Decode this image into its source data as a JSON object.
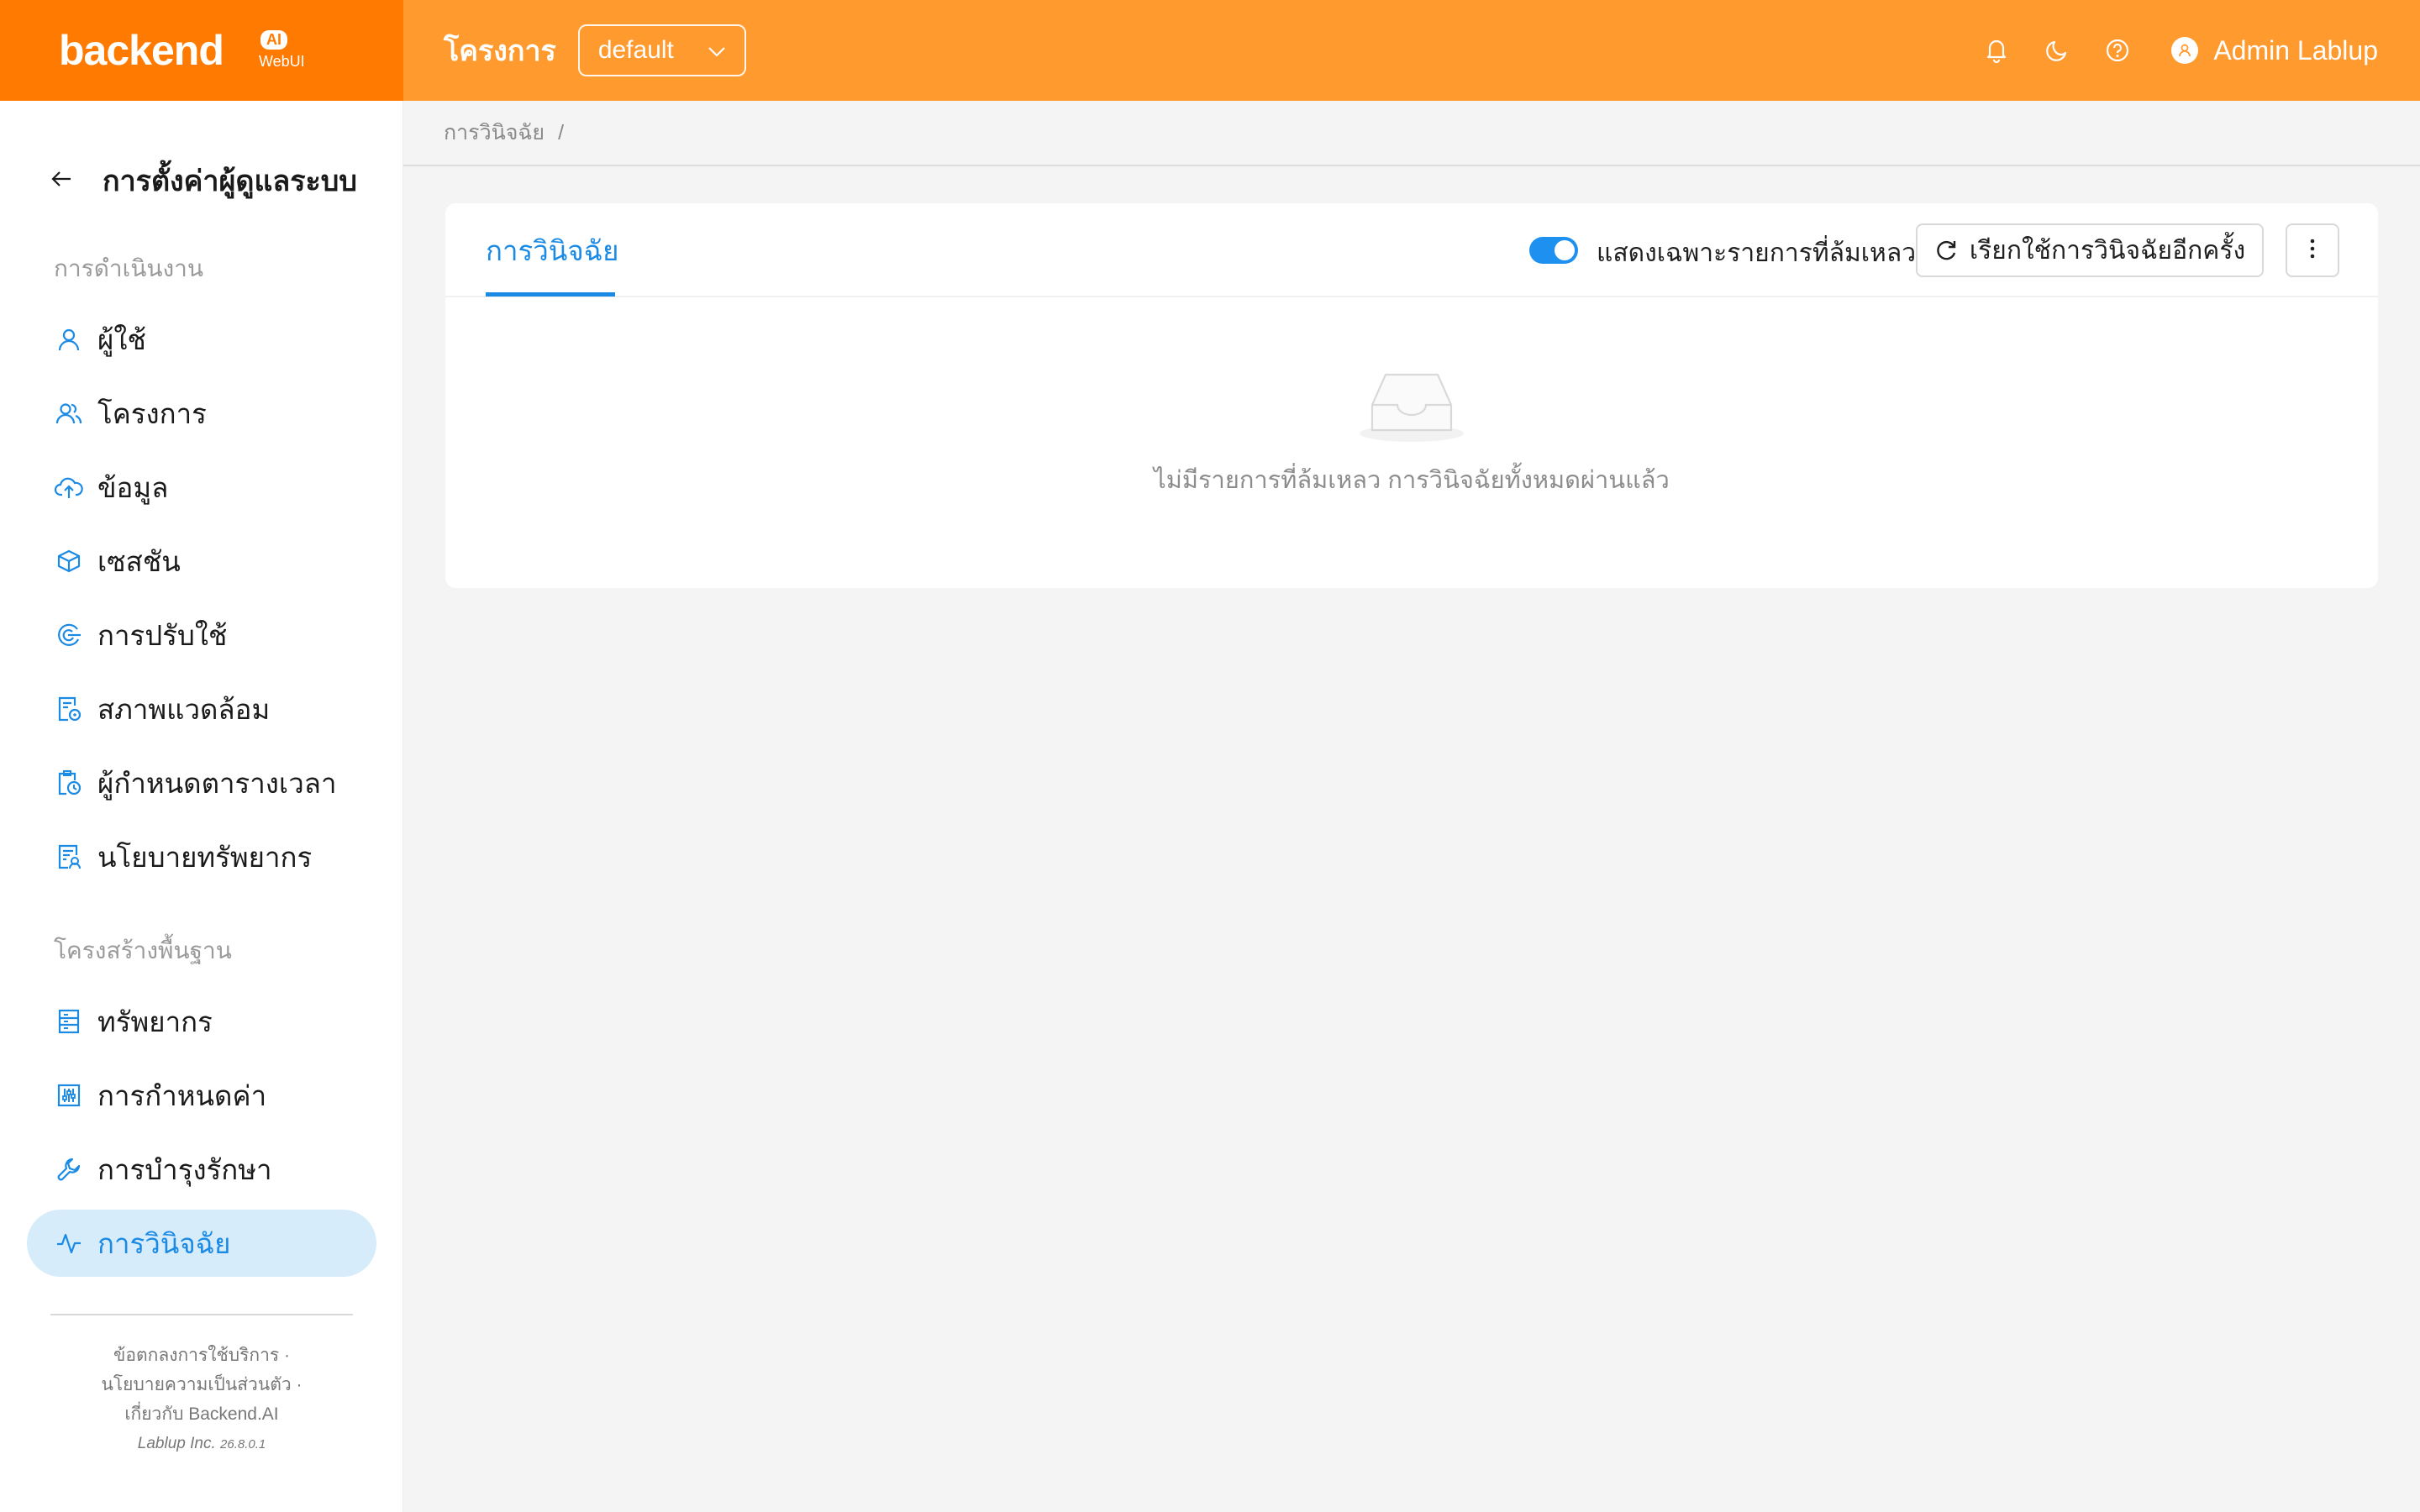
{
  "header": {
    "logo_text": "backend",
    "logo_badge": "AI",
    "logo_sub": "WebUI",
    "project_label": "โครงการ",
    "project_value": "default",
    "user_name": "Admin Lablup",
    "icons": [
      "bell-icon",
      "moon-icon",
      "help-icon",
      "user-icon"
    ]
  },
  "sidebar": {
    "title": "การตั้งค่าผู้ดูแลระบบ",
    "section_operations": "การดำเนินงาน",
    "section_infrastructure": "โครงสร้างพื้นฐาน",
    "items": [
      {
        "label": "ผู้ใช้",
        "icon": "user-icon"
      },
      {
        "label": "โครงการ",
        "icon": "team-icon"
      },
      {
        "label": "ข้อมูล",
        "icon": "cloud-upload-icon"
      },
      {
        "label": "เซสชัน",
        "icon": "cube-icon"
      },
      {
        "label": "การปรับใช้",
        "icon": "deploy-icon"
      },
      {
        "label": "สภาพแวดล้อม",
        "icon": "file-settings-icon"
      },
      {
        "label": "ผู้กำหนดตารางเวลา",
        "icon": "clipboard-clock-icon"
      },
      {
        "label": "นโยบายทรัพยากร",
        "icon": "file-policy-icon"
      },
      {
        "label": "ทรัพยากร",
        "icon": "server-icon"
      },
      {
        "label": "การกำหนดค่า",
        "icon": "sliders-icon"
      },
      {
        "label": "การบำรุงรักษา",
        "icon": "wrench-icon"
      },
      {
        "label": "การวินิจฉัย",
        "icon": "pulse-icon"
      }
    ],
    "footer": {
      "line1": "ข้อตกลงการใช้บริการ ·",
      "line2": "นโยบายความเป็นส่วนตัว ·",
      "line3": "เกี่ยวกับ Backend.AI",
      "company": "Lablup Inc.",
      "version": "26.8.0.1"
    }
  },
  "breadcrumb": {
    "current": "การวินิจฉัย",
    "separator": "/"
  },
  "diagnostics": {
    "tab_label": "การวินิจฉัย",
    "toggle_label": "แสดงเฉพาะรายการที่ล้มเหลว",
    "toggle_on": true,
    "retry_label": "เรียกใช้การวินิจฉัยอีกครั้ง",
    "empty_text": "ไม่มีรายการที่ล้มเหลว การวินิจฉัยทั้งหมดผ่านแล้ว"
  },
  "colors": {
    "header": "#ff9a2e",
    "logo_bg": "#ff7a00",
    "accent": "#1a8ae5",
    "active_bg": "#d6ecfb"
  }
}
